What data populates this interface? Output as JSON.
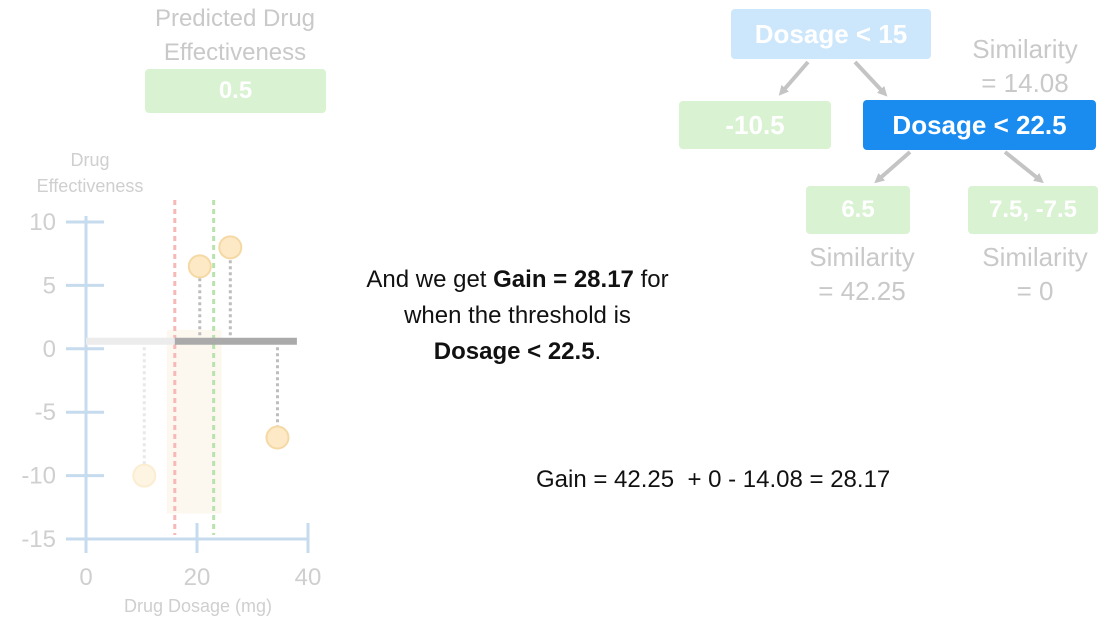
{
  "prediction": {
    "title_line1": "Predicted Drug",
    "title_line2": "Effectiveness",
    "value": "0.5"
  },
  "tree": {
    "root": {
      "label": "Dosage < 15",
      "similarity_line1": "Similarity",
      "similarity_line2": "= 14.08"
    },
    "left_leaf": {
      "label": "-10.5"
    },
    "right_node": {
      "label": "Dosage < 22.5"
    },
    "right_left_leaf": {
      "label": "6.5",
      "similarity_line1": "Similarity",
      "similarity_line2": "= 42.25"
    },
    "right_right_leaf": {
      "label": "7.5, -7.5",
      "similarity_line1": "Similarity",
      "similarity_line2": "= 0"
    }
  },
  "narration": {
    "part1": "And we get ",
    "gain_bold": "Gain = 28.17",
    "part2": " for",
    "line2": "when the threshold is",
    "threshold_bold": "Dosage < 22.5",
    "period": "."
  },
  "equation": "Gain = 42.25  + 0 - 14.08 = 28.17",
  "colors": {
    "axis": "#c6dbee",
    "point_fill": "#fde9c6",
    "point_stroke": "#f5d9a5",
    "threshold_red": "#f7b8b8",
    "threshold_green": "#b9e3ae",
    "prediction_line": "#aaaaaa"
  },
  "chart_data": {
    "type": "scatter",
    "ylabel_line1": "Drug",
    "ylabel_line2": "Effectiveness",
    "xlabel": "Drug Dosage (mg)",
    "xlim": [
      0,
      40
    ],
    "ylim": [
      -15,
      10
    ],
    "x_ticks": [
      0,
      20,
      40
    ],
    "y_ticks": [
      10,
      5,
      0,
      -5,
      -10,
      -15
    ],
    "points": [
      {
        "x": 10.5,
        "y": -10,
        "faded": true
      },
      {
        "x": 20.5,
        "y": 6.5,
        "faded": false
      },
      {
        "x": 26,
        "y": 8,
        "faded": false
      },
      {
        "x": 34.5,
        "y": -7,
        "faded": false
      }
    ],
    "thresholds": [
      {
        "x": 16,
        "color": "red"
      },
      {
        "x": 23,
        "color": "green"
      }
    ],
    "prediction_segments": [
      {
        "x_start": 0,
        "x_end": 16,
        "y": 0.6,
        "faded": true
      },
      {
        "x_start": 16,
        "x_end": 38,
        "y": 0.6,
        "faded": false
      }
    ]
  }
}
